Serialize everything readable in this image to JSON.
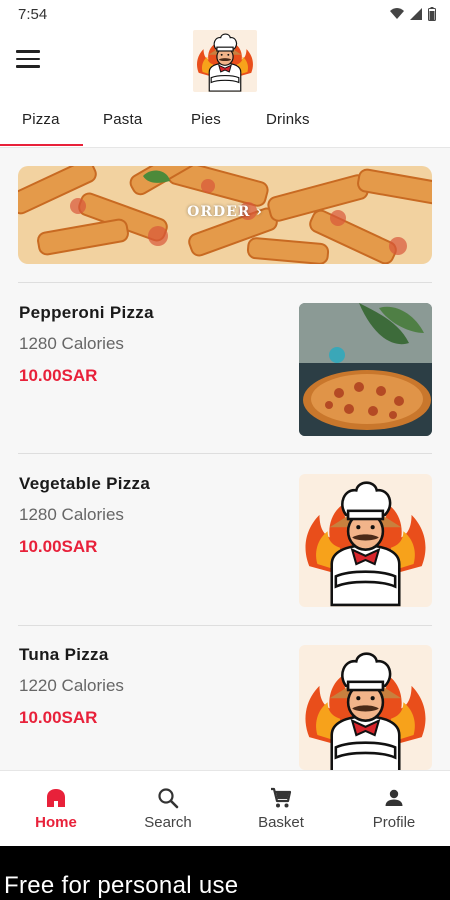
{
  "status_bar": {
    "time": "7:54"
  },
  "tabs": [
    {
      "label": "Pizza",
      "active": true
    },
    {
      "label": "Pasta",
      "active": false
    },
    {
      "label": "Pies",
      "active": false
    },
    {
      "label": "Drinks",
      "active": false
    }
  ],
  "banner": {
    "text": "ORDER ›"
  },
  "items": [
    {
      "name": "Pepperoni Pizza",
      "calories": "1280 Calories",
      "price": "10.00SAR",
      "image": "pizza-photo"
    },
    {
      "name": "Vegetable Pizza",
      "calories": "1280 Calories",
      "price": "10.00SAR",
      "image": "chef-logo"
    },
    {
      "name": "Tuna Pizza",
      "calories": "1220 Calories",
      "price": "10.00SAR",
      "image": "chef-logo"
    }
  ],
  "bottom_nav": [
    {
      "label": "Home",
      "icon": "home-icon",
      "active": true
    },
    {
      "label": "Search",
      "icon": "search-icon",
      "active": false
    },
    {
      "label": "Basket",
      "icon": "cart-icon",
      "active": false
    },
    {
      "label": "Profile",
      "icon": "person-icon",
      "active": false
    }
  ],
  "footer": {
    "text": "Free for personal use"
  },
  "colors": {
    "accent": "#e8213a",
    "background": "#f7f7f7",
    "surface": "#ffffff"
  }
}
